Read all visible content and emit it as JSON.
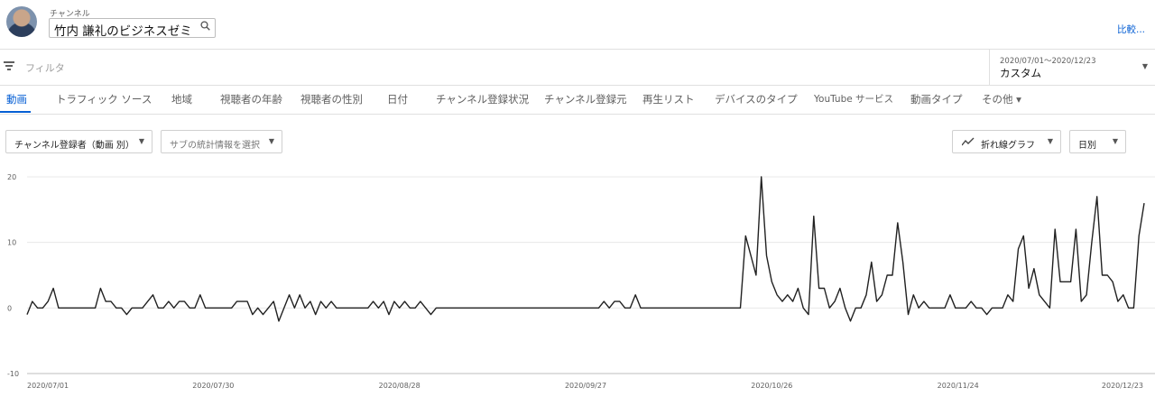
{
  "header": {
    "channel_caption": "チャンネル",
    "channel_name": "竹内 謙礼のビジネスゼミ",
    "search_icon": "search-icon",
    "compare_label": "比較..."
  },
  "filter": {
    "placeholder": "フィルタ",
    "date_range": "2020/07/01〜2020/12/23",
    "date_label": "カスタム"
  },
  "tabs": [
    {
      "label": "動画",
      "active": true
    },
    {
      "label": "トラフィック ソース"
    },
    {
      "label": "地域"
    },
    {
      "label": "視聴者の年齢"
    },
    {
      "label": "視聴者の性別"
    },
    {
      "label": "日付"
    },
    {
      "label": "チャンネル登録状況"
    },
    {
      "label": "チャンネル登録元"
    },
    {
      "label": "再生リスト"
    },
    {
      "label": "デバイスのタイプ"
    },
    {
      "label": "YouTube サービス"
    },
    {
      "label": "動画タイプ"
    },
    {
      "label": "その他 ▾"
    }
  ],
  "controls": {
    "metric": "チャンネル登録者（動画 別）",
    "secondary_metric": "サブの統計情報を選択",
    "chart_type": "折れ線グラフ",
    "granularity": "日別"
  },
  "colors": {
    "accent": "#065fd4",
    "line": "#212121"
  },
  "chart_data": {
    "type": "line",
    "x_start": "2020/07/01",
    "x_end": "2020/12/23",
    "x_tick_labels": [
      "2020/07/01",
      "2020/07/30",
      "2020/08/28",
      "2020/09/27",
      "2020/10/26",
      "2020/11/24",
      "2020/12/23"
    ],
    "y_ticks": [
      20,
      10,
      0,
      -10
    ],
    "ylim": [
      -10,
      20
    ],
    "series": [
      {
        "values": [
          -1,
          1,
          0,
          0,
          1,
          3,
          0,
          0,
          0,
          0,
          0,
          0,
          0,
          0,
          3,
          1,
          1,
          0,
          0,
          -1,
          0,
          0,
          0,
          1,
          2,
          0,
          0,
          1,
          0,
          1,
          1,
          0,
          0,
          2,
          0,
          0,
          0,
          0,
          0,
          0,
          1,
          1,
          1,
          -1,
          0,
          -1,
          0,
          1,
          -2,
          0,
          2,
          0,
          2,
          0,
          1,
          -1,
          1,
          0,
          1,
          0,
          0,
          0,
          0,
          0,
          0,
          0,
          1,
          0,
          1,
          -1,
          1,
          0,
          1,
          0,
          0,
          1,
          0,
          -1,
          0,
          0,
          0,
          0,
          0,
          0,
          0,
          0,
          0,
          0,
          0,
          0,
          0,
          0,
          0,
          0,
          0,
          0,
          0,
          0,
          0,
          0,
          0,
          0,
          0,
          0,
          0,
          0,
          0,
          0,
          0,
          0,
          1,
          0,
          1,
          1,
          0,
          0,
          2,
          0,
          0,
          0,
          0,
          0,
          0,
          0,
          0,
          0,
          0,
          0,
          0,
          0,
          0,
          0,
          0,
          0,
          0,
          0,
          0,
          11,
          8,
          5,
          20,
          8,
          4,
          2,
          1,
          2,
          1,
          3,
          0,
          -1,
          14,
          3,
          3,
          0,
          1,
          3,
          0,
          -2,
          0,
          0,
          2,
          7,
          1,
          2,
          5,
          5,
          13,
          7,
          -1,
          2,
          0,
          1,
          0,
          0,
          0,
          0,
          2,
          0,
          0,
          0,
          1,
          0,
          0,
          -1,
          0,
          0,
          0,
          2,
          1,
          9,
          11,
          3,
          6,
          2,
          1,
          0,
          12,
          4,
          4,
          4,
          12,
          1,
          2,
          10,
          17,
          5,
          5,
          4,
          1,
          2,
          0,
          0,
          11,
          16
        ]
      }
    ]
  }
}
